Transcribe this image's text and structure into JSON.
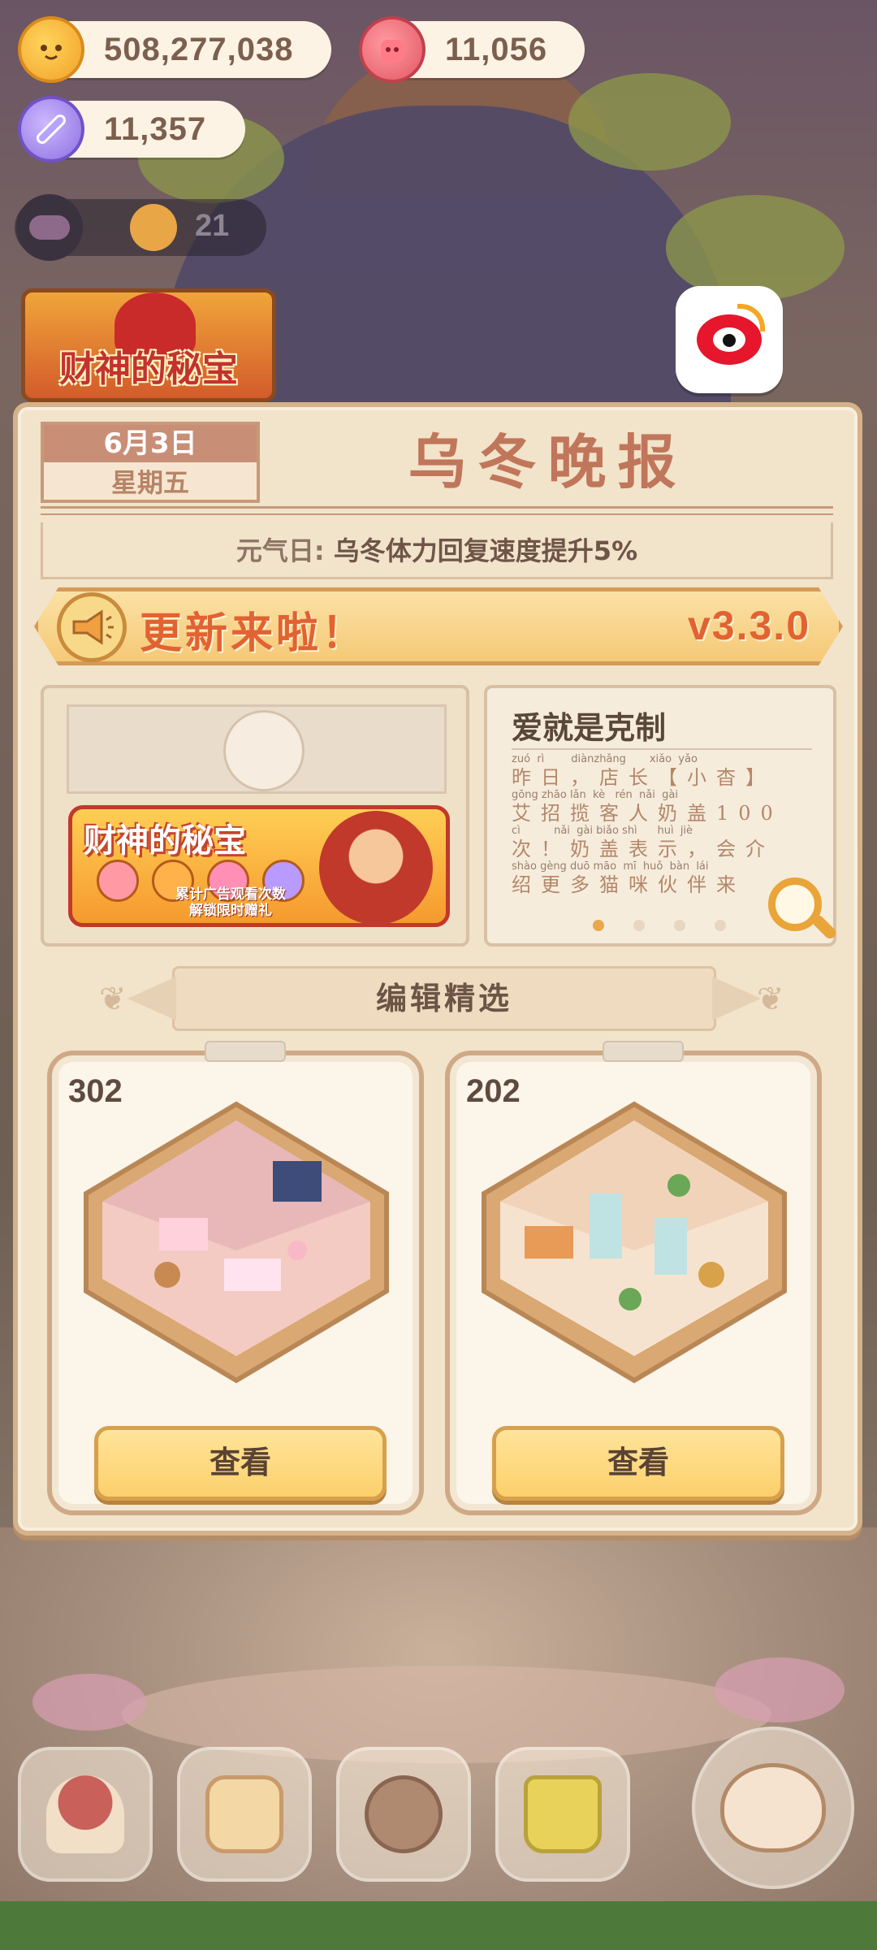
{
  "hud": {
    "coins": "508,277,038",
    "gems": "11,056",
    "candy": "11,357",
    "friends_count": "21"
  },
  "event_banner": {
    "title": "财神的秘宝"
  },
  "newspaper": {
    "date": "6月3日",
    "weekday": "星期五",
    "title": "乌冬晚报",
    "subline_label": "元气日:",
    "subline_text": " 乌冬体力回复速度提升5%",
    "update_text": "更新来啦！",
    "version": "v3.3.0",
    "promo": {
      "title": "财神的秘宝",
      "desc_line1": "累计广告观看次数",
      "desc_line2": "解锁限时赠礼"
    },
    "news": {
      "title": "爱就是克制",
      "lines": [
        {
          "pinyin": "zuó  rì        diànzhǎng       xiǎo  yǎo",
          "hanzi": "昨日，店长【小杳】"
        },
        {
          "pinyin": "gōng zhāo lǎn  kè   rén  nǎi  gài",
          "hanzi": "艾招揽客人奶盖100"
        },
        {
          "pinyin": "cì          nǎi  gài biǎo shì      huì  jiè",
          "hanzi": "次！奶盖表示，会介"
        },
        {
          "pinyin": "shào gèng duō māo  mī  huǒ  bàn  lái",
          "hanzi": "绍更多猫咪伙伴来"
        }
      ]
    },
    "section_title": "编辑精选",
    "rooms": [
      {
        "number": "302",
        "button": "查看"
      },
      {
        "number": "202",
        "button": "查看"
      }
    ]
  },
  "colors": {
    "accent": "#e26232",
    "panel": "#f2e3cb",
    "button": "#fcd06b",
    "title": "#c0765a"
  },
  "icons": {
    "coin": "cookie-coin-icon",
    "gem": "jelly-gem-icon",
    "candy": "candy-icon",
    "weibo": "weibo-icon",
    "megaphone": "megaphone-icon",
    "zoom": "magnifier-icon"
  }
}
